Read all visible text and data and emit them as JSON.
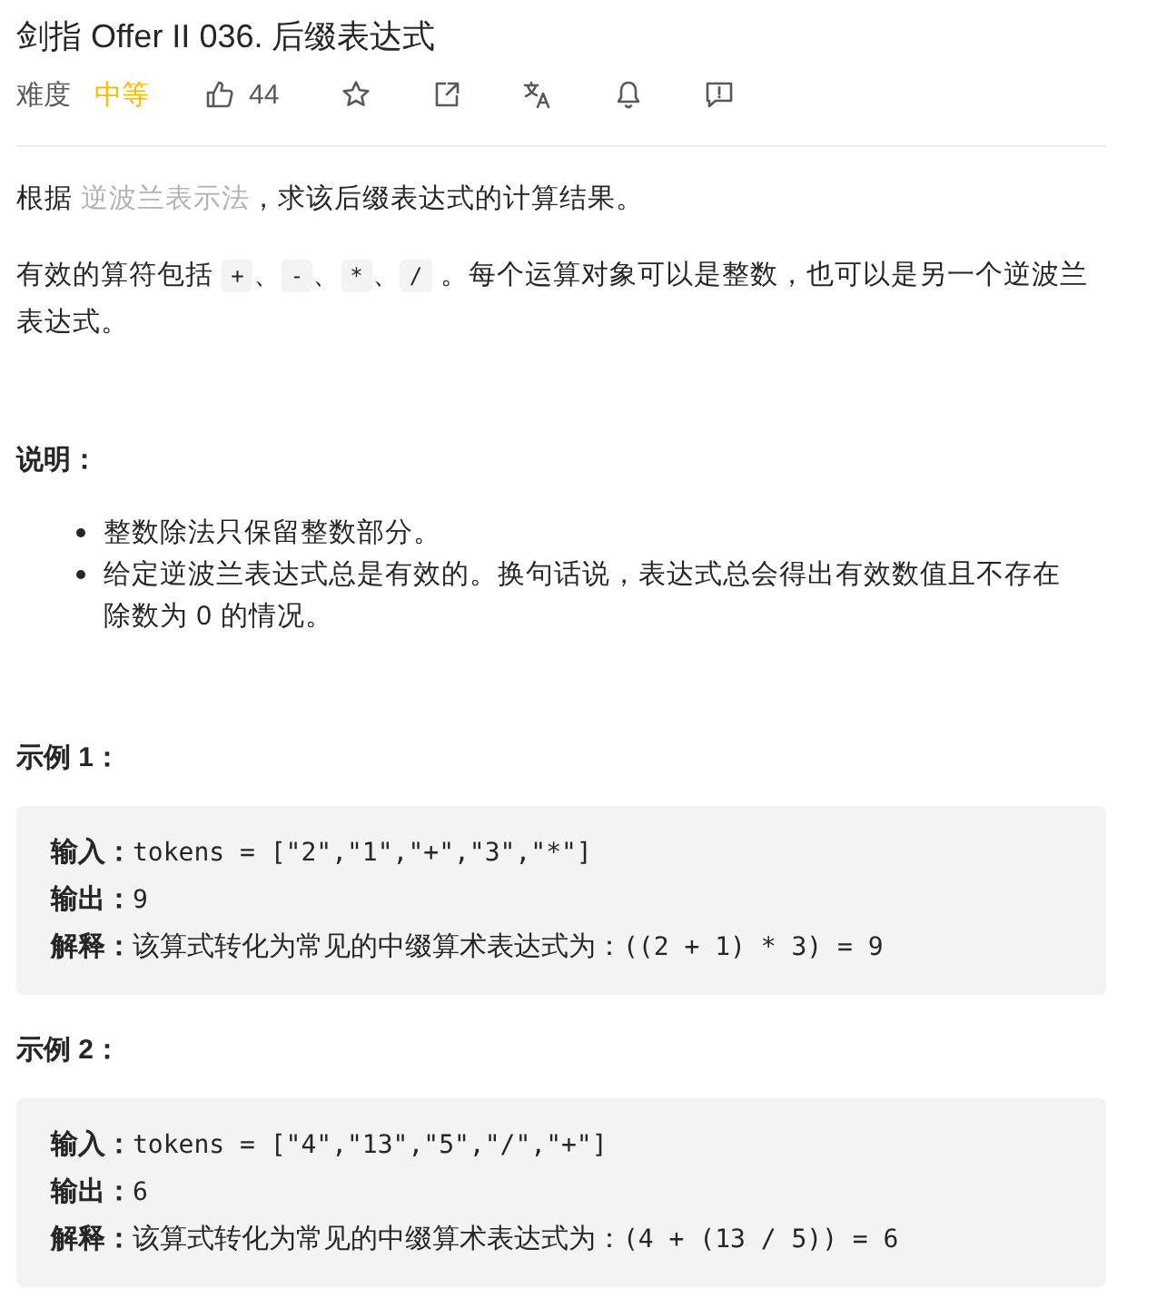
{
  "title": "剑指 Offer II 036. 后缀表达式",
  "meta": {
    "difficulty_label": "难度",
    "difficulty": {
      "text": "中等",
      "kind": "medium"
    },
    "likes": "44"
  },
  "description": [
    {
      "parts": [
        {
          "kind": "text",
          "text": "根据 "
        },
        {
          "kind": "link",
          "text": "逆波兰表示法"
        },
        {
          "kind": "text",
          "text": "，求该后缀表达式的计算结果。"
        }
      ]
    },
    {
      "parts": [
        {
          "kind": "text",
          "text": "有效的算符包括 "
        },
        {
          "kind": "code",
          "text": "+"
        },
        {
          "kind": "text",
          "text": "、"
        },
        {
          "kind": "code",
          "text": "-"
        },
        {
          "kind": "text",
          "text": "、"
        },
        {
          "kind": "code",
          "text": "*"
        },
        {
          "kind": "text",
          "text": "、"
        },
        {
          "kind": "code",
          "text": "/"
        },
        {
          "kind": "text",
          "text": " 。每个运算对象可以是整数，也可以是另一个逆波兰表达式。"
        }
      ]
    }
  ],
  "notes": {
    "heading": "说明：",
    "items": [
      "整数除法只保留整数部分。",
      "给定逆波兰表达式总是有效的。换句话说，表达式总会得出有效数值且不存在除数为 0 的情况。"
    ]
  },
  "examples": [
    {
      "heading": "示例 1：",
      "lines": [
        {
          "label": "输入：",
          "parts": [
            {
              "kind": "code",
              "text": "tokens = [\"2\",\"1\",\"+\",\"3\",\"*\"]"
            }
          ]
        },
        {
          "label": "输出：",
          "parts": [
            {
              "kind": "code",
              "text": "9"
            }
          ]
        },
        {
          "label": "解释：",
          "parts": [
            {
              "kind": "text",
              "text": "该算式转化为常见的中缀算术表达式为："
            },
            {
              "kind": "code",
              "text": "((2 + 1) * 3) = 9"
            }
          ]
        }
      ]
    },
    {
      "heading": "示例 2：",
      "lines": [
        {
          "label": "输入：",
          "parts": [
            {
              "kind": "code",
              "text": "tokens = [\"4\",\"13\",\"5\",\"/\",\"+\"]"
            }
          ]
        },
        {
          "label": "输出：",
          "parts": [
            {
              "kind": "code",
              "text": "6"
            }
          ]
        },
        {
          "label": "解释：",
          "parts": [
            {
              "kind": "text",
              "text": "该算式转化为常见的中缀算术表达式为："
            },
            {
              "kind": "code",
              "text": "(4 + (13 / 5)) = 6"
            }
          ]
        }
      ]
    }
  ]
}
